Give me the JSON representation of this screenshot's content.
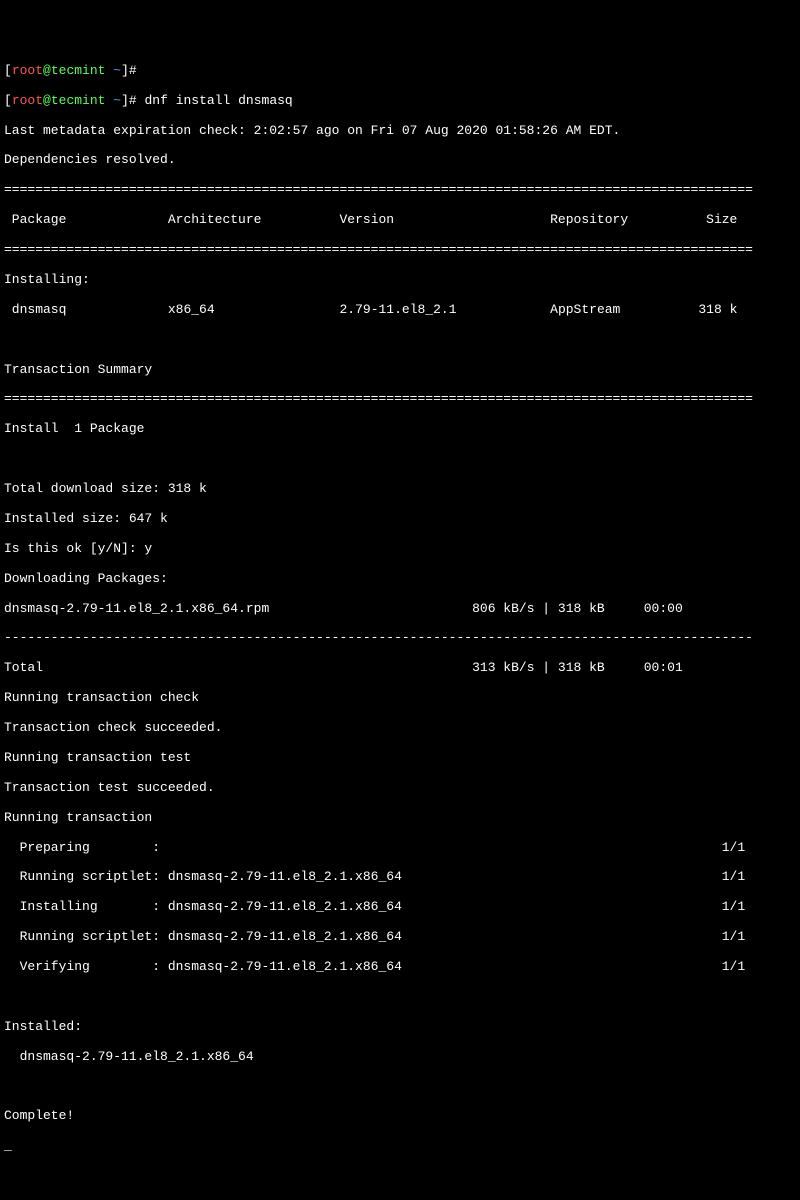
{
  "prompt": {
    "bracket_open": "[",
    "user": "root",
    "at": "@",
    "host": "tecmint",
    "path_sep": " ",
    "path": "~",
    "bracket_close": "]",
    "hash": "#"
  },
  "command": " dnf install dnsmasq",
  "metadata": "Last metadata expiration check: 2:02:57 ago on Fri 07 Aug 2020 01:58:26 AM EDT.",
  "deps": "Dependencies resolved.",
  "sep": "================================================================================================",
  "header": {
    "package": " Package",
    "arch": "Architecture",
    "version": "Version",
    "repo": "Repository",
    "size": "Size"
  },
  "installing_label": "Installing:",
  "pkg_row": {
    "name": " dnsmasq",
    "arch": "x86_64",
    "version": "2.79-11.el8_2.1",
    "repo": "AppStream",
    "size": "318 k"
  },
  "trans_summary": "Transaction Summary",
  "install_count": "Install  1 Package",
  "download_size": "Total download size: 318 k",
  "installed_size": "Installed size: 647 k",
  "confirm": "Is this ok [y/N]: y",
  "downloading": "Downloading Packages:",
  "rpm_row": {
    "file": "dnsmasq-2.79-11.el8_2.1.x86_64.rpm",
    "speed": "806 kB/s | 318 kB",
    "time": "00:00"
  },
  "dash_sep": "------------------------------------------------------------------------------------------------",
  "total_row": {
    "label": "Total",
    "speed": "313 kB/s | 318 kB",
    "time": "00:01"
  },
  "trans_check": "Running transaction check",
  "check_ok": "Transaction check succeeded.",
  "trans_test": "Running transaction test",
  "test_ok": "Transaction test succeeded.",
  "running_trans": "Running transaction",
  "steps": {
    "prep": "  Preparing        :",
    "s1": "  Running scriptlet: dnsmasq-2.79-11.el8_2.1.x86_64",
    "s2": "  Installing       : dnsmasq-2.79-11.el8_2.1.x86_64",
    "s3": "  Running scriptlet: dnsmasq-2.79-11.el8_2.1.x86_64",
    "s4": "  Verifying        : dnsmasq-2.79-11.el8_2.1.x86_64",
    "ratio": "1/1"
  },
  "installed_label": "Installed:",
  "installed_pkg": "  dnsmasq-2.79-11.el8_2.1.x86_64",
  "complete": "Complete!",
  "cursor": "_"
}
